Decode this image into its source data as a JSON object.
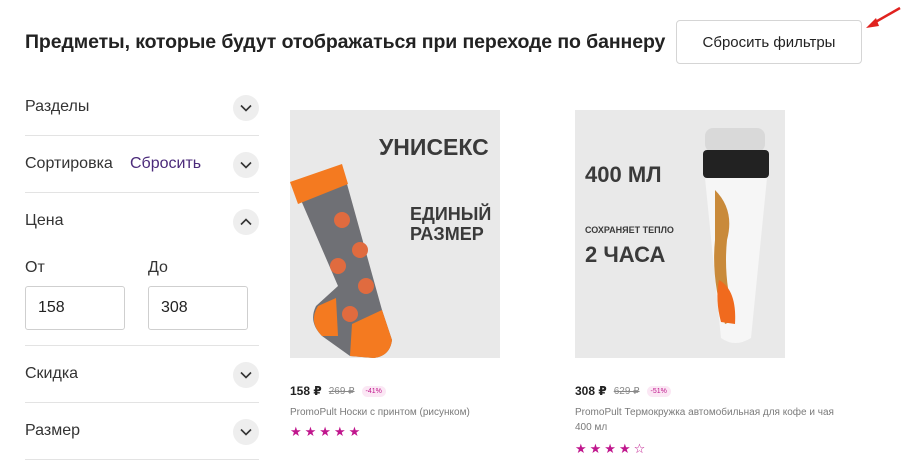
{
  "header": {
    "title": "Предметы, которые будут отображаться при переходе по баннеру",
    "reset_filters_label": "Сбросить фильтры"
  },
  "sidebar": {
    "sections": {
      "razdely": "Разделы",
      "sortirovka": "Сортировка",
      "sortirovka_reset": "Сбросить",
      "cena": "Цена",
      "skidka": "Скидка",
      "razmer": "Размер"
    },
    "price": {
      "from_label": "От",
      "to_label": "До",
      "from_value": "158",
      "to_value": "308"
    }
  },
  "products": [
    {
      "image_text": {
        "line1": "УНИСЕКС",
        "line2": "ЕДИНЫЙ",
        "line3": "РАЗМЕР"
      },
      "price": "158 ₽",
      "old_price": "269 ₽",
      "discount": "-41%",
      "title": "PromoPult Носки с принтом (рисунком)",
      "stars": "★★★★★",
      "rating": 5
    },
    {
      "image_text": {
        "line1": "400 МЛ",
        "line2": "СОХРАНЯЕТ ТЕПЛО",
        "line3": "2 ЧАСА"
      },
      "price": "308 ₽",
      "old_price": "629 ₽",
      "discount": "-51%",
      "title": "PromoPult Термокружка автомобильная для кофе и чая 400 мл",
      "stars": "★★★★☆",
      "rating": 4
    }
  ],
  "colors": {
    "accent": "#c0168d",
    "link": "#4b2a7a",
    "arrow": "#e0221f"
  }
}
